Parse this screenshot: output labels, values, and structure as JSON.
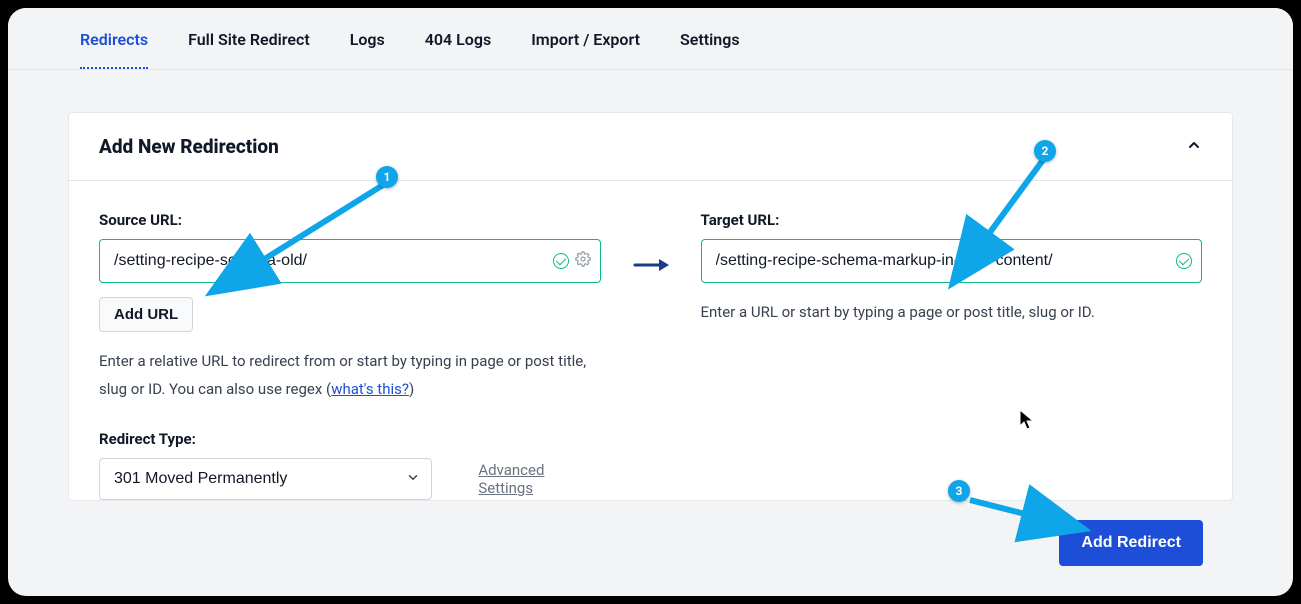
{
  "tabs": {
    "items": [
      "Redirects",
      "Full Site Redirect",
      "Logs",
      "404 Logs",
      "Import / Export",
      "Settings"
    ],
    "active_index": 0
  },
  "card": {
    "title": "Add New Redirection"
  },
  "source": {
    "label": "Source URL:",
    "value": "/setting-recipe-schema-old/",
    "add_url_label": "Add URL",
    "help_pre": "Enter a relative URL to redirect from or start by typing in page or post title, slug or ID. You can also use regex (",
    "help_link": "what's this?",
    "help_post": ")"
  },
  "target": {
    "label": "Target URL:",
    "value": "/setting-recipe-schema-markup-in-your-content/",
    "help": "Enter a URL or start by typing a page or post title, slug or ID."
  },
  "redirect_type": {
    "label": "Redirect Type:",
    "value": "301 Moved Permanently"
  },
  "advanced_link": "Advanced Settings",
  "submit_label": "Add Redirect",
  "annotations": {
    "b1": "1",
    "b2": "2",
    "b3": "3"
  }
}
